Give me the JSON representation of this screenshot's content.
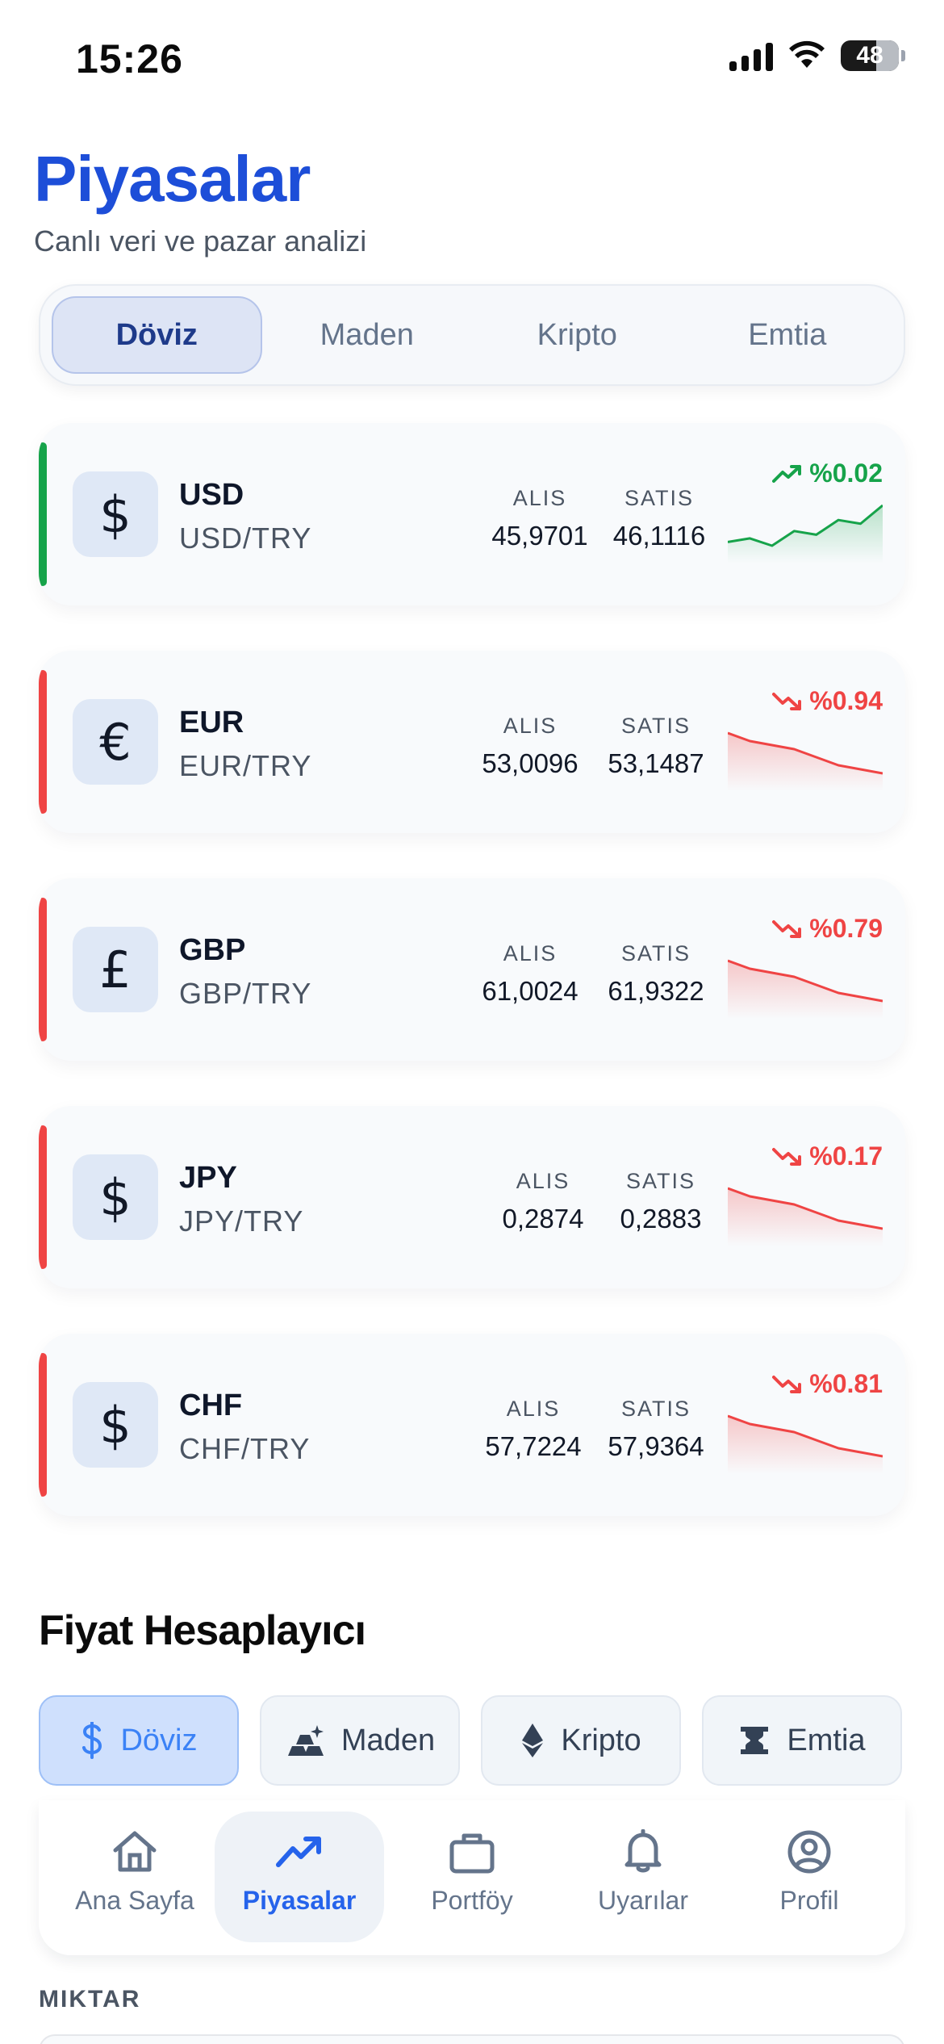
{
  "status_bar": {
    "time": "15:26",
    "battery": "48"
  },
  "header": {
    "title": "Piyasalar",
    "subtitle": "Canlı veri ve pazar analizi"
  },
  "tabs": [
    {
      "label": "Döviz",
      "active": true
    },
    {
      "label": "Maden",
      "active": false
    },
    {
      "label": "Kripto",
      "active": false
    },
    {
      "label": "Emtia",
      "active": false
    }
  ],
  "currencies": [
    {
      "symbol": "$",
      "code": "USD",
      "pair": "USD/TRY",
      "buy_label": "ALIS",
      "buy": "45,9701",
      "sell_label": "SATIS",
      "sell": "46,1116",
      "change": "%0.02",
      "trend": "up",
      "color": "#16a34a",
      "spark": [
        3,
        4,
        2,
        6,
        5,
        9,
        8,
        13
      ]
    },
    {
      "symbol": "€",
      "code": "EUR",
      "pair": "EUR/TRY",
      "buy_label": "ALIS",
      "buy": "53,0096",
      "sell_label": "SATIS",
      "sell": "53,1487",
      "change": "%0.94",
      "trend": "down",
      "color": "#ef4444",
      "spark": [
        14,
        12,
        11,
        10,
        8,
        6,
        5,
        4
      ]
    },
    {
      "symbol": "£",
      "code": "GBP",
      "pair": "GBP/TRY",
      "buy_label": "ALIS",
      "buy": "61,0024",
      "sell_label": "SATIS",
      "sell": "61,9322",
      "change": "%0.79",
      "trend": "down",
      "color": "#ef4444",
      "spark": [
        14,
        12,
        11,
        10,
        8,
        6,
        5,
        4
      ]
    },
    {
      "symbol": "$",
      "code": "JPY",
      "pair": "JPY/TRY",
      "buy_label": "ALIS",
      "buy": "0,2874",
      "sell_label": "SATIS",
      "sell": "0,2883",
      "change": "%0.17",
      "trend": "down",
      "color": "#ef4444",
      "spark": [
        14,
        12,
        11,
        10,
        8,
        6,
        5,
        4
      ]
    },
    {
      "symbol": "$",
      "code": "CHF",
      "pair": "CHF/TRY",
      "buy_label": "ALIS",
      "buy": "57,7224",
      "sell_label": "SATIS",
      "sell": "57,9364",
      "change": "%0.81",
      "trend": "down",
      "color": "#ef4444",
      "spark": [
        14,
        12,
        11,
        10,
        8,
        6,
        5,
        4
      ]
    }
  ],
  "calculator": {
    "title": "Fiyat Hesaplayıcı",
    "tabs": [
      {
        "label": "Döviz",
        "icon": "dollar-icon",
        "active": true
      },
      {
        "label": "Maden",
        "icon": "gold-bars-icon",
        "active": false
      },
      {
        "label": "Kripto",
        "icon": "ethereum-icon",
        "active": false
      },
      {
        "label": "Emtia",
        "icon": "commodity-icon",
        "active": false
      }
    ],
    "amount_label": "MIKTAR"
  },
  "bottom_nav": [
    {
      "label": "Ana Sayfa",
      "icon": "home-icon",
      "active": false
    },
    {
      "label": "Piyasalar",
      "icon": "trending-up-icon",
      "active": true
    },
    {
      "label": "Portföy",
      "icon": "briefcase-icon",
      "active": false
    },
    {
      "label": "Uyarılar",
      "icon": "bell-icon",
      "active": false
    },
    {
      "label": "Profil",
      "icon": "profile-icon",
      "active": false
    }
  ],
  "colors": {
    "accent": "#1d4ed8",
    "up": "#16a34a",
    "down": "#ef4444",
    "nav_active": "#2563eb"
  }
}
